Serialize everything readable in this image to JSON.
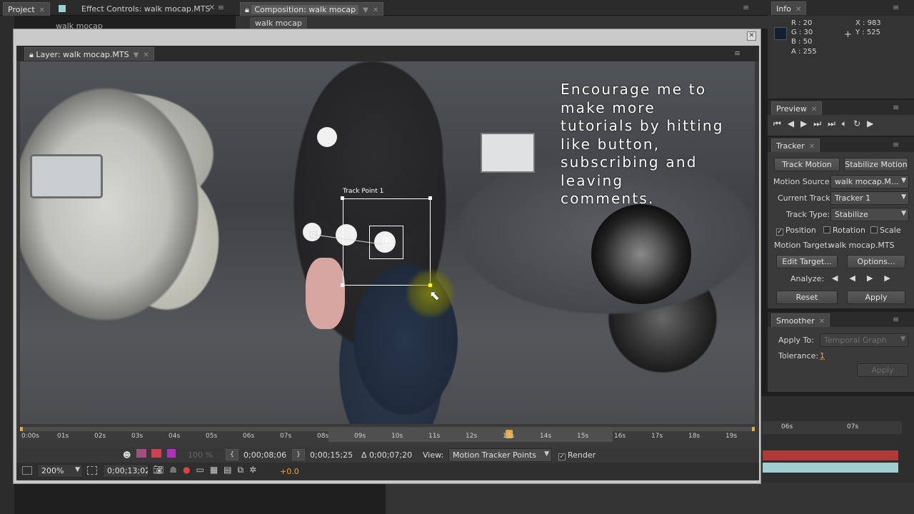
{
  "project_panel": {
    "tab_project": "Project",
    "tab_effect": "Effect Controls: walk mocap.MTS",
    "item": "walk mocap"
  },
  "composition": {
    "tab": "Composition: walk mocap",
    "subtab": "walk mocap"
  },
  "layer_window": {
    "tab": "Layer: walk mocap.MTS",
    "track_point_label": "Track Point 1",
    "overlay_text": "Encourage me to\nmake more\ntutorials by hitting\nlike button,\nsubscribing and\nleaving\ncomments.",
    "ruler_ticks": [
      "0:00s",
      "01s",
      "02s",
      "03s",
      "04s",
      "05s",
      "06s",
      "07s",
      "08s",
      "09s",
      "10s",
      "11s",
      "12s",
      "13s",
      "14s",
      "15s",
      "16s",
      "17s",
      "18s",
      "19s"
    ],
    "in_point": "0;00;08;06",
    "out_point": "0;00;15;25",
    "duration": "Δ 0;00;07;20",
    "view_label": "View:",
    "view_value": "Motion Tracker Points",
    "render_label": "Render",
    "opacity": "100 %",
    "zoom": "200%",
    "current_time": "0;00;13;02",
    "exposure": "+0.0"
  },
  "info_panel": {
    "tab": "Info",
    "r": "R : 20",
    "g": "G : 30",
    "b": "B : 50",
    "a": "A : 255",
    "x": "X : 983",
    "y": "Y : 525",
    "swatch_color": "#142032"
  },
  "preview_panel": {
    "tab": "Preview"
  },
  "tracker_panel": {
    "tab": "Tracker",
    "track_motion": "Track Motion",
    "stabilize_motion": "Stabilize Motion",
    "motion_source_label": "Motion Source:",
    "motion_source_value": "walk mocap.M...",
    "current_track_label": "Current Track:",
    "current_track_value": "Tracker 1",
    "track_type_label": "Track Type:",
    "track_type_value": "Stabilize",
    "position": "Position",
    "rotation": "Rotation",
    "scale": "Scale",
    "motion_target": "Motion Target:",
    "motion_target_value": "walk mocap.MTS",
    "edit_target": "Edit Target...",
    "options": "Options...",
    "analyze": "Analyze:",
    "reset": "Reset",
    "apply": "Apply"
  },
  "smoother_panel": {
    "tab": "Smoother",
    "apply_to_label": "Apply To:",
    "apply_to_value": "Temporal Graph",
    "tolerance_label": "Tolerance:",
    "tolerance_value": "1",
    "apply": "Apply"
  },
  "timeline_right": {
    "t1": "06s",
    "t2": "07s"
  },
  "colors": {
    "accent": "#e8a93a",
    "track_box": "#ffffff",
    "layer_red": "#b03a3a",
    "layer_teal": "#9fcfcf"
  }
}
